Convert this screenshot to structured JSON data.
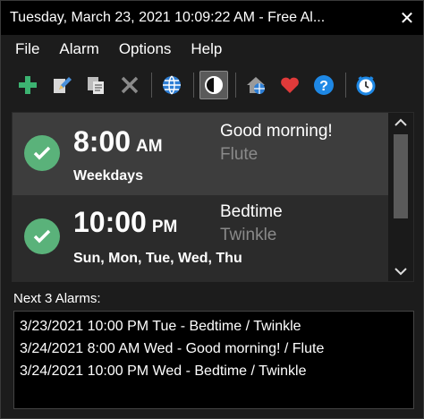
{
  "window": {
    "title": "Tuesday, March 23, 2021 10:09:22 AM - Free Al...",
    "close_glyph": "✕"
  },
  "menu": [
    "File",
    "Alarm",
    "Options",
    "Help"
  ],
  "toolbar": {
    "icons": [
      "add-icon",
      "edit-icon",
      "clone-icon",
      "delete-icon",
      "globe-icon",
      "contrast-icon",
      "home-icon",
      "heart-icon",
      "help-icon",
      "clock-icon"
    ],
    "colors": {
      "add": "#3cb371",
      "heart": "#e03a3a",
      "help": "#1e88e5",
      "globe": "#2e7fd6"
    }
  },
  "alarms": [
    {
      "time": "8:00",
      "ampm": "AM",
      "days": "Weekdays",
      "label": "Good morning!",
      "sound": "Flute",
      "enabled": true
    },
    {
      "time": "10:00",
      "ampm": "PM",
      "days": "Sun, Mon, Tue, Wed, Thu",
      "label": "Bedtime",
      "sound": "Twinkle",
      "enabled": true
    }
  ],
  "scroll": {
    "up": "⌃",
    "down": "⌄"
  },
  "next_alarms": {
    "label": "Next 3 Alarms:",
    "items": [
      "3/23/2021 10:00 PM Tue - Bedtime / Twinkle",
      "3/24/2021 8:00 AM Wed - Good morning! / Flute",
      "3/24/2021 10:00 PM Wed - Bedtime / Twinkle"
    ]
  }
}
